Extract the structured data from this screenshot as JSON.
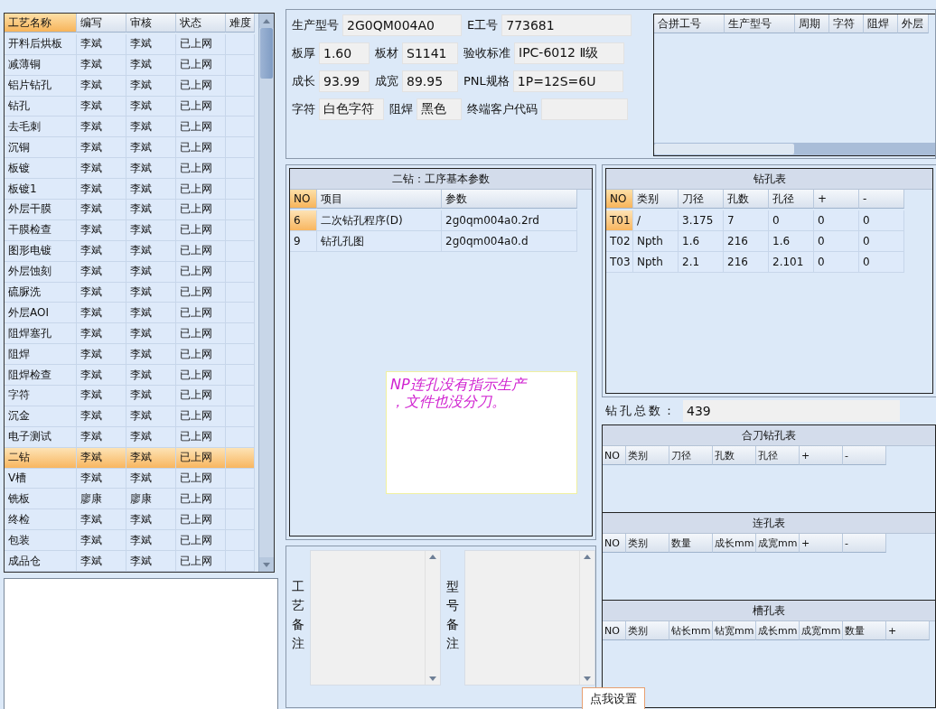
{
  "process_list": {
    "columns": [
      {
        "label": "工艺名称",
        "selected": true
      },
      {
        "label": "编写",
        "selected": false
      },
      {
        "label": "审核",
        "selected": false
      },
      {
        "label": "状态",
        "selected": false
      },
      {
        "label": "难度",
        "selected": false
      }
    ],
    "rows": [
      {
        "name": "开料后烘板",
        "writer": "李斌",
        "reviewer": "李斌",
        "status": "已上网",
        "selected": false
      },
      {
        "name": "减薄铜",
        "writer": "李斌",
        "reviewer": "李斌",
        "status": "已上网",
        "selected": false
      },
      {
        "name": "铝片钻孔",
        "writer": "李斌",
        "reviewer": "李斌",
        "status": "已上网",
        "selected": false
      },
      {
        "name": "钻孔",
        "writer": "李斌",
        "reviewer": "李斌",
        "status": "已上网",
        "selected": false
      },
      {
        "name": "去毛刺",
        "writer": "李斌",
        "reviewer": "李斌",
        "status": "已上网",
        "selected": false
      },
      {
        "name": "沉铜",
        "writer": "李斌",
        "reviewer": "李斌",
        "status": "已上网",
        "selected": false
      },
      {
        "name": "板镀",
        "writer": "李斌",
        "reviewer": "李斌",
        "status": "已上网",
        "selected": false
      },
      {
        "name": "板镀1",
        "writer": "李斌",
        "reviewer": "李斌",
        "status": "已上网",
        "selected": false
      },
      {
        "name": "外层干膜",
        "writer": "李斌",
        "reviewer": "李斌",
        "status": "已上网",
        "selected": false
      },
      {
        "name": "干膜检查",
        "writer": "李斌",
        "reviewer": "李斌",
        "status": "已上网",
        "selected": false
      },
      {
        "name": "图形电镀",
        "writer": "李斌",
        "reviewer": "李斌",
        "status": "已上网",
        "selected": false
      },
      {
        "name": "外层蚀刻",
        "writer": "李斌",
        "reviewer": "李斌",
        "status": "已上网",
        "selected": false
      },
      {
        "name": "硫脲洗",
        "writer": "李斌",
        "reviewer": "李斌",
        "status": "已上网",
        "selected": false
      },
      {
        "name": "外层AOI",
        "writer": "李斌",
        "reviewer": "李斌",
        "status": "已上网",
        "selected": false
      },
      {
        "name": "阻焊塞孔",
        "writer": "李斌",
        "reviewer": "李斌",
        "status": "已上网",
        "selected": false
      },
      {
        "name": "阻焊",
        "writer": "李斌",
        "reviewer": "李斌",
        "status": "已上网",
        "selected": false
      },
      {
        "name": "阻焊检查",
        "writer": "李斌",
        "reviewer": "李斌",
        "status": "已上网",
        "selected": false
      },
      {
        "name": "字符",
        "writer": "李斌",
        "reviewer": "李斌",
        "status": "已上网",
        "selected": false
      },
      {
        "name": "沉金",
        "writer": "李斌",
        "reviewer": "李斌",
        "status": "已上网",
        "selected": false
      },
      {
        "name": "电子测试",
        "writer": "李斌",
        "reviewer": "李斌",
        "status": "已上网",
        "selected": false
      },
      {
        "name": "二钻",
        "writer": "李斌",
        "reviewer": "李斌",
        "status": "已上网",
        "selected": true
      },
      {
        "name": "V槽",
        "writer": "李斌",
        "reviewer": "李斌",
        "status": "已上网",
        "selected": false
      },
      {
        "name": "铣板",
        "writer": "廖康",
        "reviewer": "廖康",
        "status": "已上网",
        "selected": false
      },
      {
        "name": "终检",
        "writer": "李斌",
        "reviewer": "李斌",
        "status": "已上网",
        "selected": false
      },
      {
        "name": "包装",
        "writer": "李斌",
        "reviewer": "李斌",
        "status": "已上网",
        "selected": false
      },
      {
        "name": "成品仓",
        "writer": "李斌",
        "reviewer": "李斌",
        "status": "已上网",
        "selected": false
      }
    ]
  },
  "info_rows": [
    [
      {
        "label": "生产型号",
        "value": "2G0QM004A0"
      },
      {
        "label": "E工号",
        "value": "773681"
      }
    ],
    [
      {
        "label": "板厚",
        "value": "1.60"
      },
      {
        "label": "板材",
        "value": "S1141"
      },
      {
        "label": "验收标准",
        "value": "IPC-6012 Ⅱ级"
      }
    ],
    [
      {
        "label": "成长",
        "value": "93.99"
      },
      {
        "label": "成宽",
        "value": "89.95"
      },
      {
        "label": "PNL规格",
        "value": "1P=12S=6U"
      }
    ],
    [
      {
        "label": "字符",
        "value": "白色字符"
      },
      {
        "label": "阻焊",
        "value": "黑色"
      },
      {
        "label": "终端客户代码"
      }
    ]
  ],
  "merge_grid": {
    "columns": [
      "合拼工号",
      "生产型号",
      "周期",
      "字符",
      "阻焊",
      "外层"
    ]
  },
  "params_panel": {
    "title": "二钻：工序基本参数",
    "columns": [
      "NO",
      "项目",
      "参数"
    ],
    "rows": [
      {
        "no": "6",
        "item": "二次钻孔程序(D)",
        "param": "2g0qm004a0.2rd",
        "selected": true
      },
      {
        "no": "9",
        "item": "钻孔孔图",
        "param": "2g0qm004a0.d",
        "selected": false
      }
    ],
    "note_lines": [
      "NP连孔没有指示生产",
      "，文件也没分刀。"
    ]
  },
  "drill_table": {
    "title": "钻孔表",
    "columns": [
      "NO",
      "类别",
      "刀径",
      "孔数",
      "孔径",
      "+",
      "-"
    ],
    "rows": [
      {
        "cells": [
          "T01",
          "/",
          "3.175",
          "7",
          "0",
          "0",
          "0"
        ],
        "selected": true
      },
      {
        "cells": [
          "T02",
          "Npth",
          "1.6",
          "216",
          "1.6",
          "0",
          "0"
        ],
        "selected": false
      },
      {
        "cells": [
          "T03",
          "Npth",
          "2.1",
          "216",
          "2.101",
          "0",
          "0"
        ],
        "selected": false
      }
    ],
    "total_label": "钻孔总数：",
    "total_value": "439"
  },
  "sub_tables": [
    {
      "title": "合刀钻孔表",
      "columns": [
        "NO",
        "类别",
        "刀径",
        "孔数",
        "孔径",
        "+",
        "-"
      ]
    },
    {
      "title": "连孔表",
      "columns": [
        "NO",
        "类别",
        "数量",
        "成长mm",
        "成宽mm",
        "+",
        "-"
      ]
    },
    {
      "title": "槽孔表",
      "columns": [
        "NO",
        "类别",
        "钻长mm",
        "钻宽mm",
        "成长mm",
        "成宽mm",
        "数量",
        "+"
      ]
    }
  ],
  "remarks": [
    {
      "label": "工艺备注"
    },
    {
      "label": "型号备注"
    }
  ],
  "settings_button": "点我设置"
}
